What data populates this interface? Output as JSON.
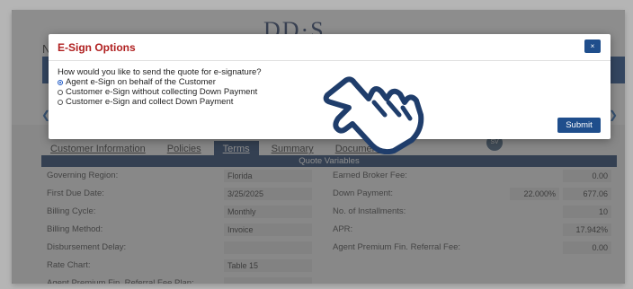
{
  "app": {
    "logo_text": "DD·S",
    "side_letter": "N"
  },
  "tabs": [
    {
      "label": "Customer Information"
    },
    {
      "label": "Policies"
    },
    {
      "label": "Terms"
    },
    {
      "label": "Summary"
    },
    {
      "label": "Documents"
    }
  ],
  "badge": "SV",
  "quote_variables": {
    "header": "Quote Variables",
    "left": [
      {
        "label": "Governing Region:",
        "value": "Florida"
      },
      {
        "label": "First Due Date:",
        "value": "3/25/2025"
      },
      {
        "label": "Billing Cycle:",
        "value": "Monthly"
      },
      {
        "label": "Billing Method:",
        "value": "Invoice"
      },
      {
        "label": "Disbursement Delay:",
        "value": ""
      },
      {
        "label": "Rate Chart:",
        "value": "Table 15"
      },
      {
        "label": "Agent Premium Fin. Referral Fee Plan:",
        "value": ""
      }
    ],
    "right": [
      {
        "label": "Earned Broker Fee:",
        "value": "0.00"
      },
      {
        "label": "Down Payment:",
        "pct": "22.000%",
        "value": "677.06"
      },
      {
        "label": "No. of Installments:",
        "value": "10"
      },
      {
        "label": "APR:",
        "value": "17.942%"
      },
      {
        "label": "Agent Premium Fin. Referral Fee:",
        "value": "0.00"
      }
    ]
  },
  "modal": {
    "title": "E-Sign Options",
    "close_label": "×",
    "question": "How would you like to send the quote for e-signature?",
    "options": [
      {
        "label": "Agent e-Sign on behalf of the Customer",
        "selected": true
      },
      {
        "label": "Customer e-Sign without collecting Down Payment",
        "selected": false
      },
      {
        "label": "Customer e-Sign and collect Down Payment",
        "selected": false
      }
    ],
    "submit_label": "Submit"
  },
  "colors": {
    "accent": "#1f4e8c",
    "title_red": "#b02020",
    "header_navy": "#1f3d6b"
  },
  "icons": {
    "pointer": "pointing-hand-icon"
  }
}
